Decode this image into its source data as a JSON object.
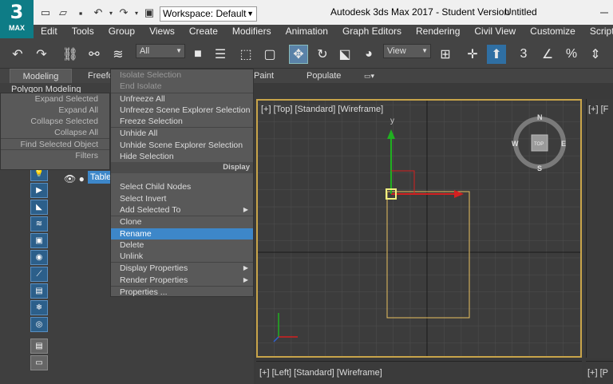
{
  "app": {
    "logo_number": "3",
    "logo_text": "MAX",
    "title": "Autodesk 3ds Max 2017 - Student Version",
    "document": "Untitled"
  },
  "workspace": {
    "label": "Workspace: Default"
  },
  "menubar": {
    "items": [
      "Edit",
      "Tools",
      "Group",
      "Views",
      "Create",
      "Modifiers",
      "Animation",
      "Graph Editors",
      "Rendering",
      "Civil View",
      "Customize",
      "Script"
    ]
  },
  "toolbar": {
    "filter_value": "All",
    "view_value": "View",
    "snap_label": "3"
  },
  "ribbon": {
    "tabs": [
      "Modeling",
      "Freeform",
      "Paint",
      "Populate"
    ],
    "subtitle": "Polygon Modeling"
  },
  "scene": {
    "node_label": "Table"
  },
  "context_left": {
    "items": [
      "Expand Selected",
      "Expand All",
      "Collapse Selected",
      "Collapse All",
      "Find Selected Object",
      "Filters"
    ]
  },
  "context_right": {
    "items": [
      {
        "label": "Isolate Selection",
        "enabled": false
      },
      {
        "label": "End Isolate",
        "enabled": false
      },
      {
        "label": "Unfreeze All",
        "enabled": true
      },
      {
        "label": "Unfreeze Scene Explorer Selection",
        "enabled": true
      },
      {
        "label": "Freeze Selection",
        "enabled": true
      },
      {
        "label": "Unhide All",
        "enabled": true
      },
      {
        "label": "Unhide Scene Explorer Selection",
        "enabled": true
      },
      {
        "label": "Hide Selection",
        "enabled": true
      }
    ],
    "section_display": "Display",
    "items2": [
      {
        "label": "Select Child Nodes",
        "enabled": true
      },
      {
        "label": "Select Invert",
        "enabled": true
      },
      {
        "label": "Add Selected To",
        "enabled": true,
        "submenu": true
      },
      {
        "label": "Clone",
        "enabled": true
      },
      {
        "label": "Rename",
        "enabled": true,
        "hover": true
      },
      {
        "label": "Delete",
        "enabled": true
      },
      {
        "label": "Unlink",
        "enabled": true
      },
      {
        "label": "Display Properties",
        "enabled": true,
        "submenu": true
      },
      {
        "label": "Render Properties",
        "enabled": true,
        "submenu": true
      },
      {
        "label": "Properties ...",
        "enabled": true
      }
    ]
  },
  "viewports": {
    "top_label": "[+] [Top] [Standard] [Wireframe]",
    "left_label": "[+] [Left] [Standard] [Wireframe]",
    "right_cut_label": "[+] [F",
    "br_cut_label": "[+] [P",
    "viewcube": {
      "n": "N",
      "s": "S",
      "e": "E",
      "w": "W",
      "face": "TOP"
    },
    "axis_y": "y"
  },
  "colors": {
    "accent": "#3d87c9",
    "active_viewport_border": "#c8a44a",
    "object_wire": "#e8c060",
    "gizmo_x": "#d42020",
    "gizmo_y": "#20b020"
  }
}
